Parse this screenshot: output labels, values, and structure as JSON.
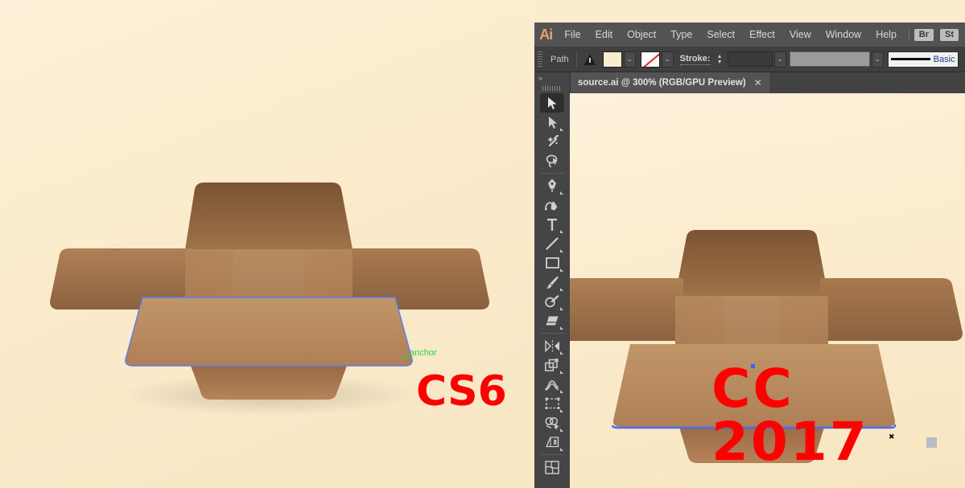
{
  "app": {
    "name": "Adobe Illustrator",
    "logo_text": "Ai"
  },
  "menubar": {
    "items": [
      {
        "label": "File"
      },
      {
        "label": "Edit"
      },
      {
        "label": "Object"
      },
      {
        "label": "Type"
      },
      {
        "label": "Select"
      },
      {
        "label": "Effect"
      },
      {
        "label": "View"
      },
      {
        "label": "Window"
      },
      {
        "label": "Help"
      }
    ],
    "right_buttons": [
      {
        "label": "Br",
        "name": "bridge-button"
      },
      {
        "label": "St",
        "name": "stock-button"
      }
    ]
  },
  "control_bar": {
    "selection_type": "Path",
    "warning_icon": "warning-triangle-icon",
    "fill_swatch_color": "#FBEBCF",
    "stroke_swatch_color": "none",
    "stroke_label": "Stroke:",
    "stroke_weight_value": "",
    "opacity_value": "",
    "brush_definition": "Basic",
    "caret_glyph": "⌄"
  },
  "document_tab": {
    "title": "source.ai @ 300% (RGB/GPU Preview)",
    "close_glyph": "✕",
    "zoom_level": "300%",
    "color_mode": "RGB",
    "preview_mode": "GPU Preview",
    "file_name": "source.ai"
  },
  "tool_panel": {
    "collapse_glyph": "»",
    "tools": [
      {
        "name": "selection-tool",
        "label": "Selection Tool",
        "active": true
      },
      {
        "name": "direct-selection-tool",
        "label": "Direct Selection Tool",
        "active": false
      },
      {
        "name": "magic-wand-tool",
        "label": "Magic Wand Tool",
        "active": false
      },
      {
        "name": "lasso-tool",
        "label": "Lasso Tool",
        "active": false
      },
      {
        "name": "pen-tool",
        "label": "Pen Tool",
        "active": false
      },
      {
        "name": "curvature-tool",
        "label": "Curvature Tool",
        "active": false
      },
      {
        "name": "type-tool",
        "label": "Type Tool",
        "active": false
      },
      {
        "name": "line-segment-tool",
        "label": "Line Segment Tool",
        "active": false
      },
      {
        "name": "rectangle-tool",
        "label": "Rectangle Tool",
        "active": false
      },
      {
        "name": "paintbrush-tool",
        "label": "Paintbrush Tool",
        "active": false
      },
      {
        "name": "shaper-tool",
        "label": "Shaper Tool",
        "active": false
      },
      {
        "name": "eraser-tool",
        "label": "Eraser Tool",
        "active": false
      },
      {
        "name": "rotate-tool",
        "label": "Rotate Tool",
        "active": false
      },
      {
        "name": "scale-tool",
        "label": "Scale Tool",
        "active": false
      },
      {
        "name": "width-tool",
        "label": "Width Tool",
        "active": false
      },
      {
        "name": "free-transform-tool",
        "label": "Free Transform Tool",
        "active": false
      },
      {
        "name": "shape-builder-tool",
        "label": "Shape Builder Tool",
        "active": false
      },
      {
        "name": "perspective-grid-tool",
        "label": "Perspective Grid Tool",
        "active": false
      },
      {
        "name": "mesh-tool",
        "label": "Mesh Tool",
        "active": false
      }
    ]
  },
  "artwork": {
    "subject": "open cardboard box",
    "box_colors": {
      "flap_dark": "#7B5336",
      "flap_mid": "#9A6E49",
      "flap_light": "#B5886');",
      "front_light": "#C2976B",
      "front_mid": "#AE8057",
      "inner_dark": "#6E482B"
    },
    "selection_stroke_color": "#4A6CF7",
    "canvas_background": "#FAEBCD"
  },
  "annotations": {
    "cs6_tag": "CS6",
    "cc_tag": "CC 2017",
    "tag_color": "#FF0000",
    "smart_guide_label": "anchor",
    "smart_guide_color": "#2BD34A"
  }
}
